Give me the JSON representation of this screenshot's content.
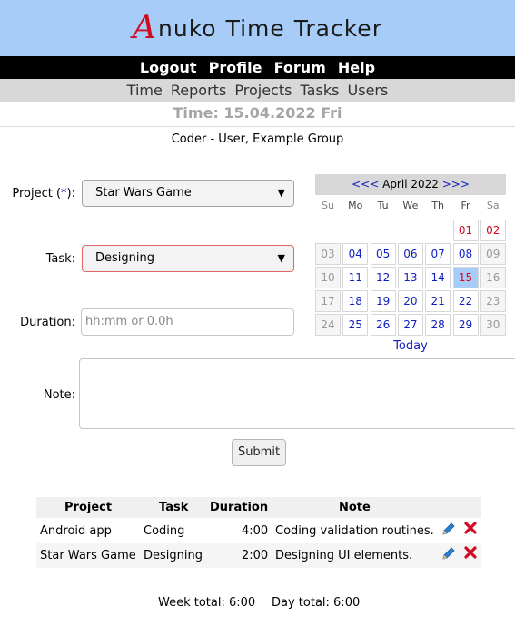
{
  "app": {
    "logo_first": "A",
    "logo_rest_1": "nuko",
    "logo_word_2": "Time",
    "logo_word_3": "Tracker"
  },
  "top_menu": [
    "Logout",
    "Profile",
    "Forum",
    "Help"
  ],
  "sub_menu": [
    "Time",
    "Reports",
    "Projects",
    "Tasks",
    "Users"
  ],
  "date_title": "Time: 15.04.2022 Fri",
  "user_group": "Coder - User, Example Group",
  "form": {
    "project_label": "Project (",
    "project_req": "*",
    "project_label_end": "):",
    "project_value": "Star Wars Game",
    "task_label": "Task:",
    "task_value": "Designing",
    "duration_label": "Duration:",
    "duration_placeholder": "hh:mm or 0.0h",
    "note_label": "Note:",
    "submit_label": "Submit"
  },
  "calendar": {
    "prev": "<<<",
    "month": "April 2022",
    "next": ">>>",
    "dow": [
      "Su",
      "Mo",
      "Tu",
      "We",
      "Th",
      "Fr",
      "Sa"
    ],
    "weeks": [
      [
        "",
        "",
        "",
        "",
        "",
        "01",
        "02"
      ],
      [
        "03",
        "04",
        "05",
        "06",
        "07",
        "08",
        "09"
      ],
      [
        "10",
        "11",
        "12",
        "13",
        "14",
        "15",
        "16"
      ],
      [
        "17",
        "18",
        "19",
        "20",
        "21",
        "22",
        "23"
      ],
      [
        "24",
        "25",
        "26",
        "27",
        "28",
        "29",
        "30"
      ]
    ],
    "selected_day": "15",
    "today_label": "Today"
  },
  "table": {
    "headers": [
      "Project",
      "Task",
      "Duration",
      "Note"
    ],
    "rows": [
      {
        "project": "Android app",
        "task": "Coding",
        "duration": "4:00",
        "note": "Coding validation routines."
      },
      {
        "project": "Star Wars Game",
        "task": "Designing",
        "duration": "2:00",
        "note": "Designing UI elements."
      }
    ]
  },
  "totals": {
    "week": "Week total: 6:00",
    "day": "Day total: 6:00"
  },
  "colors": {
    "banner": "#a6ccf7",
    "accent_red": "#d10a1f",
    "link_blue": "#1020c0"
  }
}
